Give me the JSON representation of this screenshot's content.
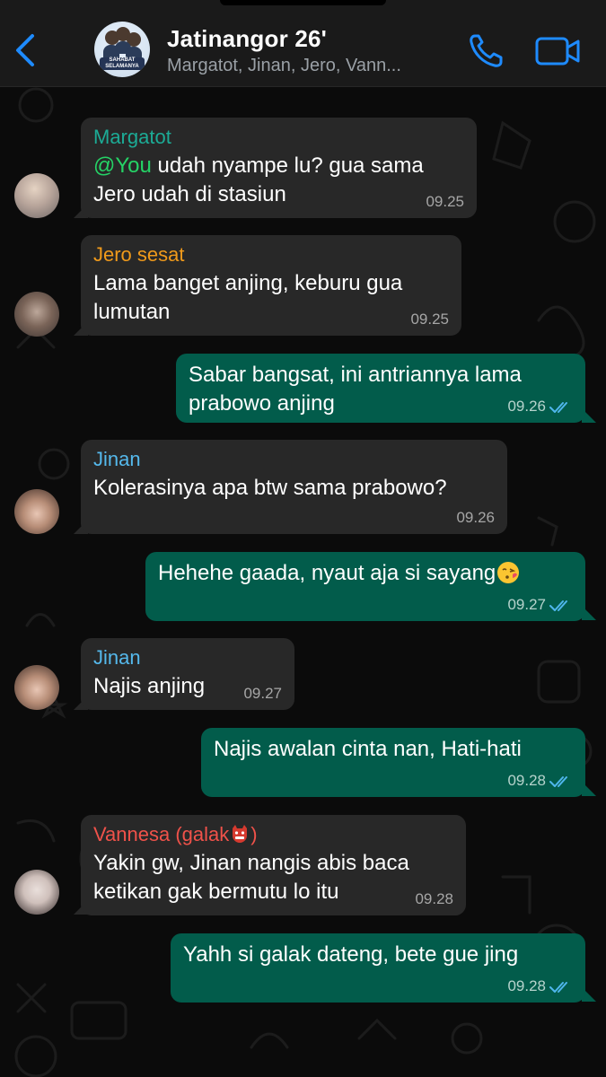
{
  "header": {
    "title": "Jatinangor 26'",
    "subtitle": "Margatot, Jinan, Jero, Vann...",
    "avatar_banner": "SAHABAT SELAMANYA",
    "icons": [
      "chevron-left-icon",
      "phone-icon",
      "video-camera-icon"
    ],
    "accent_color": "#1e8bff"
  },
  "messages": [
    {
      "direction": "incoming",
      "sender": "Margatot",
      "sender_color": "#1cab96",
      "mention": "@You",
      "text": " udah nyampe lu? gua sama\nJero udah di stasiun",
      "time": "09.25"
    },
    {
      "direction": "incoming",
      "sender": "Jero sesat",
      "sender_color": "#f09a1b",
      "text": "Lama banget anjing, keburu gua\nlumutan",
      "time": "09.25"
    },
    {
      "direction": "outgoing",
      "text": "Sabar bangsat, ini antriannya lama\nprabowo anjing",
      "time": "09.26",
      "status": "read"
    },
    {
      "direction": "incoming",
      "sender": "Jinan",
      "sender_color": "#55b9ec",
      "text": "Kolerasinya apa btw sama prabowo?",
      "time": "09.26"
    },
    {
      "direction": "outgoing",
      "text": "Hehehe gaada, nyaut aja si sayang",
      "emoji": "face-blowing-kiss",
      "time": "09.27",
      "status": "read"
    },
    {
      "direction": "incoming",
      "sender": "Jinan",
      "sender_color": "#55b9ec",
      "text": "Najis anjing",
      "time": "09.27"
    },
    {
      "direction": "outgoing",
      "text": "Najis awalan cinta nan, Hati-hati",
      "time": "09.28",
      "status": "read"
    },
    {
      "direction": "incoming",
      "sender": "Vannesa (galak",
      "sender_suffix": ")",
      "sender_emoji": "ogre",
      "sender_color": "#f0524a",
      "text": "Yakin gw, Jinan nangis abis baca\nketikan gak bermutu lo itu",
      "time": "09.28"
    },
    {
      "direction": "outgoing",
      "text": "Yahh si galak dateng, bete gue jing",
      "time": "09.28",
      "status": "read"
    }
  ],
  "colors": {
    "incoming_bubble": "#282828",
    "outgoing_bubble": "#025c4b",
    "read_ticks": "#4fb6ec"
  }
}
